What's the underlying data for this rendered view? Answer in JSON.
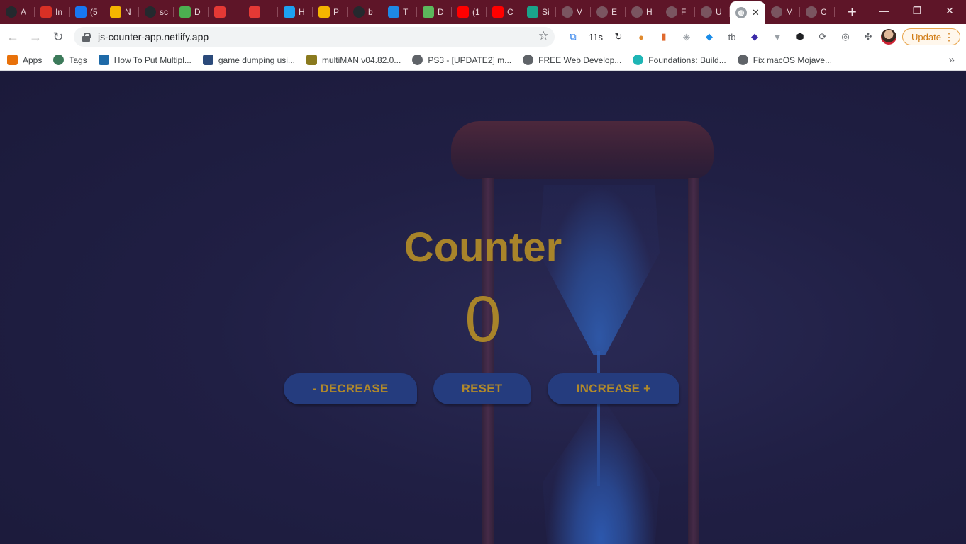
{
  "tabs": [
    {
      "label": "A",
      "icon": "github-icon",
      "color": "#24292e"
    },
    {
      "label": "In",
      "icon": "gmail-icon",
      "color": "#d93025"
    },
    {
      "label": "(5",
      "icon": "facebook-icon",
      "color": "#1877f2"
    },
    {
      "label": "N",
      "icon": "notes-icon",
      "color": "#f4b400"
    },
    {
      "label": "sc",
      "icon": "github-icon",
      "color": "#24292e"
    },
    {
      "label": "D",
      "icon": "cube-icon",
      "color": "#4caf50"
    },
    {
      "label": "",
      "icon": "stack-icon",
      "color": "#e53935"
    },
    {
      "label": "",
      "icon": "record-icon",
      "color": "#e53935"
    },
    {
      "label": "H",
      "icon": "twitter-icon",
      "color": "#1da1f2"
    },
    {
      "label": "P",
      "icon": "notes-icon",
      "color": "#f4b400"
    },
    {
      "label": "b",
      "icon": "github-icon",
      "color": "#24292e"
    },
    {
      "label": "T",
      "icon": "freecodecamp-icon",
      "color": "#1e88e5"
    },
    {
      "label": "D",
      "icon": "dev-icon",
      "color": "#5cb85c"
    },
    {
      "label": "(1",
      "icon": "youtube-icon",
      "color": "#ff0000"
    },
    {
      "label": "C",
      "icon": "youtube-icon",
      "color": "#ff0000"
    },
    {
      "label": "Si",
      "icon": "diamond-icon",
      "color": "#1aa38a"
    },
    {
      "label": "V",
      "icon": "globe-icon",
      "color": "#7a5560"
    },
    {
      "label": "E",
      "icon": "globe-icon",
      "color": "#7a5560"
    },
    {
      "label": "H",
      "icon": "globe-icon",
      "color": "#7a5560"
    },
    {
      "label": "F",
      "icon": "globe-icon",
      "color": "#7a5560"
    },
    {
      "label": "U",
      "icon": "globe-icon",
      "color": "#7a5560"
    }
  ],
  "active_tab": {
    "icon": "globe-icon",
    "close": "✕"
  },
  "tabs_after": [
    {
      "label": "M",
      "icon": "globe-icon",
      "color": "#7a5560"
    },
    {
      "label": "C",
      "icon": "globe-icon",
      "color": "#7a5560"
    }
  ],
  "new_tab": "+",
  "window_controls": {
    "minimize": "—",
    "restore": "❐",
    "close": "✕"
  },
  "toolbar": {
    "back": "←",
    "forward": "→",
    "reload": "↻",
    "url": "js-counter-app.netlify.app",
    "bookmark_star": "☆",
    "update_label": "Update",
    "menu_dots": "⋮"
  },
  "extensions": [
    {
      "icon": "translate-icon",
      "glyph": "⧉",
      "color": "#1a73e8"
    },
    {
      "icon": "timer-icon",
      "glyph": "11s",
      "color": "#202124"
    },
    {
      "icon": "refresh-icon",
      "glyph": "↻",
      "color": "#202124"
    },
    {
      "icon": "owl-icon",
      "glyph": "●",
      "color": "#e08a2e"
    },
    {
      "icon": "bottle-icon",
      "glyph": "▮",
      "color": "#e06a2e"
    },
    {
      "icon": "shield-icon",
      "glyph": "◈",
      "color": "#9aa0a6"
    },
    {
      "icon": "shield-blue-icon",
      "glyph": "◆",
      "color": "#1a8ce8"
    },
    {
      "icon": "tb-icon",
      "glyph": "tb",
      "color": "#5f6368"
    },
    {
      "icon": "hat-icon",
      "glyph": "◆",
      "color": "#3b2aa8"
    },
    {
      "icon": "vue-icon",
      "glyph": "▼",
      "color": "#9aa0a6"
    },
    {
      "icon": "box-icon",
      "glyph": "⬢",
      "color": "#202124"
    },
    {
      "icon": "sync-icon",
      "glyph": "⟳",
      "color": "#5f6368"
    },
    {
      "icon": "code-icon",
      "glyph": "◎",
      "color": "#5f6368"
    },
    {
      "icon": "puzzle-icon",
      "glyph": "✣",
      "color": "#5f6368"
    }
  ],
  "bookmarks": [
    {
      "label": "Apps",
      "icon": "apps-grid-icon",
      "color": "#e8710a"
    },
    {
      "label": "Tags",
      "icon": "tags-icon",
      "color": "#3c7a5a"
    },
    {
      "label": "How To Put Multipl...",
      "icon": "b-icon",
      "color": "#1e6aa8"
    },
    {
      "label": "game dumping usi...",
      "icon": "psx-icon",
      "color": "#2b4a7a"
    },
    {
      "label": "multiMAN v04.82.0...",
      "icon": "multiman-icon",
      "color": "#8a7a1e"
    },
    {
      "label": "PS3 - [UPDATE2] m...",
      "icon": "globe-icon",
      "color": "#5f6368"
    },
    {
      "label": "FREE Web Develop...",
      "icon": "globe-icon",
      "color": "#5f6368"
    },
    {
      "label": "Foundations: Build...",
      "icon": "foundations-icon",
      "color": "#1eb5b5"
    },
    {
      "label": "Fix macOS Mojave...",
      "icon": "cog-icon",
      "color": "#5f6368"
    }
  ],
  "bookmarks_more": "»",
  "app": {
    "title": "Counter",
    "value": "0",
    "buttons": {
      "decrease": "- DECREASE",
      "reset": "RESET",
      "increase": "INCREASE +"
    }
  }
}
